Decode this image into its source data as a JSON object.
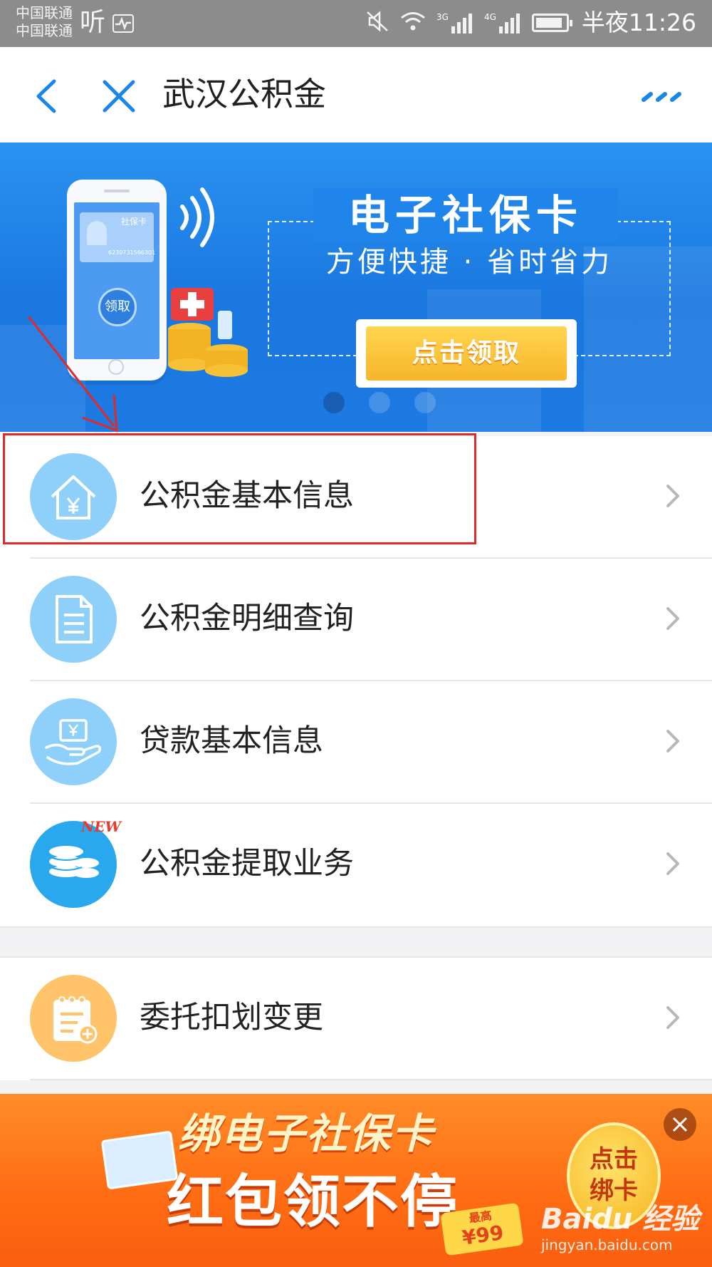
{
  "status_bar": {
    "carrier1": "中国联通",
    "carrier2": "中国联通",
    "ting": "听",
    "net1": "3G",
    "net2": "4G",
    "time": "半夜11:26"
  },
  "title_bar": {
    "title": "武汉公积金"
  },
  "banner": {
    "title": "电子社保卡",
    "subtitle": "方便快捷 · 省时省力",
    "button": "点击领取",
    "phone_card_title": "社保卡",
    "phone_card_number": "6230731566301",
    "phone_claim": "领取"
  },
  "menu": {
    "items": [
      {
        "label": "公积金基本信息",
        "icon": "house-yen-icon",
        "color": "#8fd0fb"
      },
      {
        "label": "公积金明细查询",
        "icon": "document-icon",
        "color": "#8fd0fb"
      },
      {
        "label": "贷款基本信息",
        "icon": "hand-money-icon",
        "color": "#8fd0fb"
      },
      {
        "label": "公积金提取业务",
        "icon": "coins-icon",
        "color": "#29a8ee",
        "tag": "NEW"
      }
    ],
    "items2": [
      {
        "label": "委托扣划变更",
        "icon": "notepad-plus-icon",
        "color": "#ffc369"
      }
    ]
  },
  "ad": {
    "line1": "绑电子社保卡",
    "line2": "红包领不停",
    "tag_small": "最高",
    "tag_price": "¥99",
    "circle_line1": "点击",
    "circle_line2": "绑卡",
    "watermark1": "Baidu 经验",
    "watermark2": "jingyan.baidu.com"
  },
  "colors": {
    "accent_blue": "#1a86e8",
    "highlight_red": "#e02a2a",
    "ad_orange": "#ff6c13"
  }
}
